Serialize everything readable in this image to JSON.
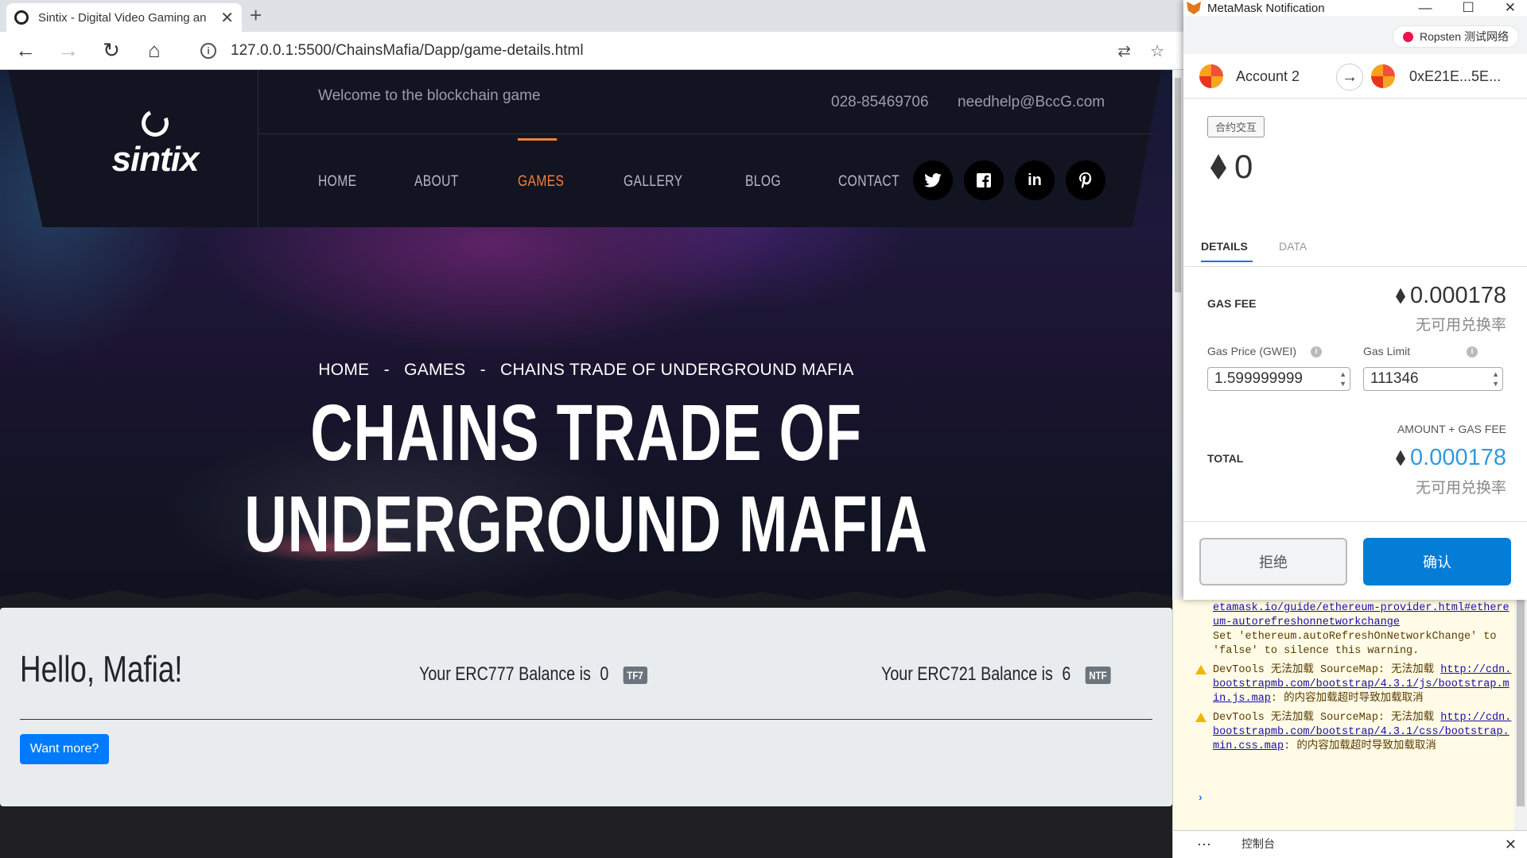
{
  "browser": {
    "tab_title": "Sintix - Digital Video Gaming an",
    "tab_close": "✕",
    "new_tab": "+",
    "url": "127.0.0.1:5500/ChainsMafia/Dapp/game-details.html",
    "info_icon": "i"
  },
  "site": {
    "logo_text": "sintix",
    "welcome": "Welcome to the blockchain game",
    "phone": "028-85469706",
    "email": "needhelp@BccG.com",
    "nav": [
      "HOME",
      "ABOUT",
      "GAMES",
      "GALLERY",
      "BLOG",
      "CONTACT"
    ],
    "active_nav": "GAMES",
    "social": [
      "t",
      "f",
      "in",
      "p"
    ],
    "breadcrumb": {
      "home": "HOME",
      "sep1": "-",
      "games": "GAMES",
      "sep2": "-",
      "current": "CHAINS TRADE OF UNDERGROUND MAFIA"
    },
    "hero_title": "CHAINS TRADE OF UNDERGROUND MAFIA",
    "hello": "Hello, Mafia!",
    "erc777_label": "Your ERC777 Balance is",
    "erc777_value": "0",
    "erc777_badge": "TF7",
    "erc721_label": "Your ERC721 Balance is",
    "erc721_value": "6",
    "erc721_badge": "NTF",
    "want_more": "Want more?"
  },
  "metamask": {
    "window_title": "MetaMask Notification",
    "network": "Ropsten 测试网络",
    "network_color": "#e91550",
    "from_account": "Account 2",
    "to_account": "0xE21E...5E...",
    "tx_type": "合约交互",
    "amount": "0",
    "tabs": {
      "details": "DETAILS",
      "data": "DATA"
    },
    "gas_fee_label": "GAS FEE",
    "gas_fee": "0.000178",
    "gas_fee_rate": "无可用兑换率",
    "gas_price_label": "Gas Price (GWEI)",
    "gas_price": "1.599999999",
    "gas_limit_label": "Gas Limit",
    "gas_limit": "111346",
    "amount_plus_gas_label": "AMOUNT + GAS FEE",
    "total_label": "TOTAL",
    "total": "0.000178",
    "total_rate": "无可用兑换率",
    "reject": "拒绝",
    "confirm": "确认",
    "accent_color": "#037dd6"
  },
  "devtools": {
    "msg1_link": "etamask.io/guide/ethereum-provider.html#ethereum-autorefreshonnetworkchange",
    "msg1_text": "Set 'ethereum.autoRefreshOnNetworkChange' to 'false' to silence this warning.",
    "msg2_prefix": "DevTools 无法加载 SourceMap: 无法加载 ",
    "msg2_link": "http://cdn.bootstrapmb.com/bootstrap/4.3.1/js/bootstrap.min.js.map",
    "msg2_suffix": ": 的内容加载超时导致加载取消",
    "msg3_prefix": "DevTools 无法加载 SourceMap: 无法加载 ",
    "msg3_link": "http://cdn.bootstrapmb.com/bootstrap/4.3.1/css/bootstrap.min.css.map",
    "msg3_suffix": ": 的内容加载超时导致加载取消",
    "prompt": "›",
    "more": "⋯",
    "console_tab": "控制台",
    "close": "✕"
  }
}
